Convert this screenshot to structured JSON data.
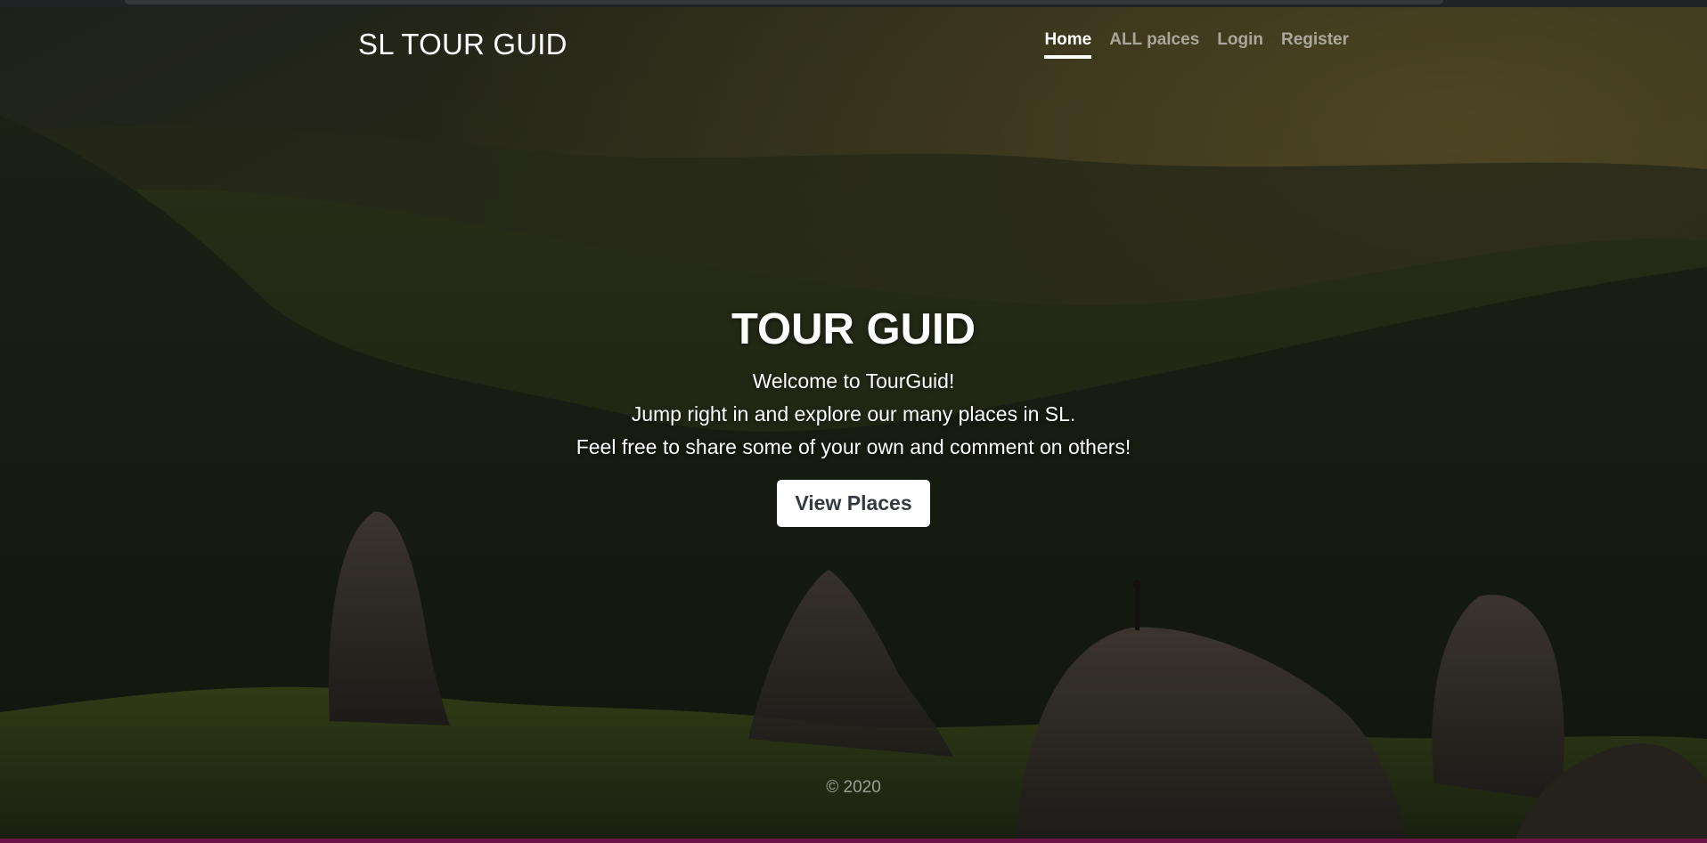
{
  "navbar": {
    "brand": "SL TOUR GUID",
    "links": [
      {
        "label": "Home",
        "active": true
      },
      {
        "label": "ALL palces",
        "active": false
      },
      {
        "label": "Login",
        "active": false
      },
      {
        "label": "Register",
        "active": false
      }
    ]
  },
  "hero": {
    "title": "TOUR GUID",
    "lines": [
      "Welcome to TourGuid!",
      "Jump right in and explore our many places in SL.",
      "Feel free to share some of your own and comment on others!"
    ],
    "cta_label": "View Places"
  },
  "footer": {
    "text": "© 2020"
  },
  "colors": {
    "nav_active": "#ffffff",
    "nav_inactive": "rgba(255,255,255,0.55)",
    "cta_bg": "#ffffff",
    "cta_text": "#343a40",
    "bottom_bar": "#6b1446"
  }
}
